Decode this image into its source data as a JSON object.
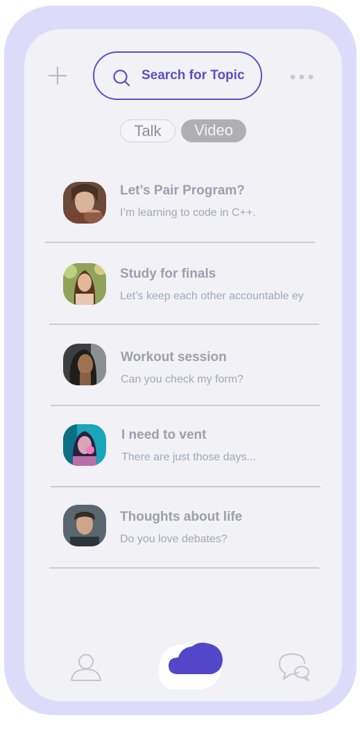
{
  "header": {
    "add_icon": "plus-icon",
    "search": {
      "label": "Search for Topic",
      "icon": "search-icon"
    },
    "more_icon": "more-dots-icon"
  },
  "tabs": [
    {
      "label": "Talk",
      "selected": false
    },
    {
      "label": "Video",
      "selected": true
    }
  ],
  "topics": [
    {
      "title": "Let’s Pair Program?",
      "subtitle": "I’m learning to code in C++."
    },
    {
      "title": "Study for finals",
      "subtitle": "Let’s keep each other accountable ey"
    },
    {
      "title": "Workout session",
      "subtitle": "Can you check my form?"
    },
    {
      "title": "I need to vent",
      "subtitle": "There are just those days..."
    },
    {
      "title": "Thoughts about life",
      "subtitle": "Do you love debates?"
    }
  ],
  "bottom_nav": [
    {
      "icon": "profile-icon",
      "active": false
    },
    {
      "icon": "cloud-icon",
      "active": true
    },
    {
      "icon": "chat-bubbles-icon",
      "active": false
    }
  ],
  "colors": {
    "accent": "#5a4fc8",
    "device_frame": "#dcdcfa",
    "screen_bg": "#f2f1f5",
    "muted_text": "#9aa0ad"
  }
}
